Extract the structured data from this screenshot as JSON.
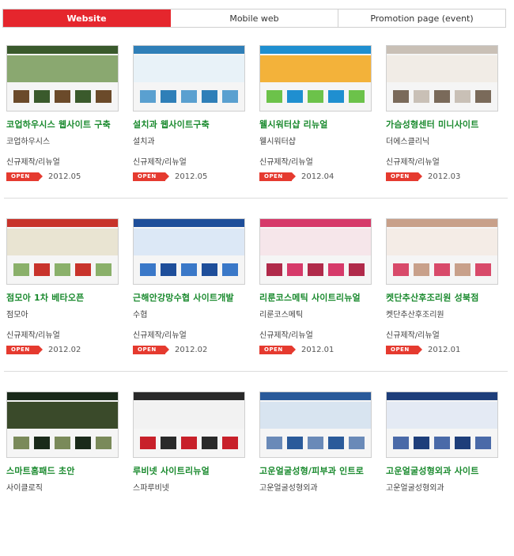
{
  "tabs": [
    {
      "label": "Website",
      "active": true
    },
    {
      "label": "Mobile web",
      "active": false
    },
    {
      "label": "Promotion page (event)",
      "active": false
    }
  ],
  "badge_label": "OPEN",
  "rows": [
    [
      {
        "title": "코업하우시스 웹사이트 구축",
        "client": "코업하우시스",
        "kind": "신규제작/리뉴얼",
        "date": "2012.05",
        "colors": [
          "#3a5a2c",
          "#8aa870",
          "#6b4a2a"
        ]
      },
      {
        "title": "설치과 웹사이트구축",
        "client": "설치과",
        "kind": "신규제작/리뉴얼",
        "date": "2012.05",
        "colors": [
          "#2f7fb8",
          "#e8f2f8",
          "#5aa0d0"
        ]
      },
      {
        "title": "웰시워터샵 리뉴얼",
        "client": "웰시워터샵",
        "kind": "신규제작/리뉴얼",
        "date": "2012.04",
        "colors": [
          "#1f8fd0",
          "#f3b23a",
          "#6cc24a"
        ]
      },
      {
        "title": "가슴성형센터 미니사이트",
        "client": "더에스클리닉",
        "kind": "신규제작/리뉴얼",
        "date": "2012.03",
        "colors": [
          "#c9c0b6",
          "#f1ece6",
          "#7a6a5a"
        ]
      }
    ],
    [
      {
        "title": "점모아 1차 베타오픈",
        "client": "점모아",
        "kind": "신규제작/리뉴얼",
        "date": "2012.02",
        "colors": [
          "#c8332b",
          "#e9e4d2",
          "#8ab06a"
        ]
      },
      {
        "title": "근해안강망수협 사이트개발",
        "client": "수협",
        "kind": "신규제작/리뉴얼",
        "date": "2012.02",
        "colors": [
          "#1e4e9a",
          "#dce8f6",
          "#3a78c8"
        ]
      },
      {
        "title": "리룬코스메틱 사이트리뉴얼",
        "client": "리룬코스메틱",
        "kind": "신규제작/리뉴얼",
        "date": "2012.01",
        "colors": [
          "#d63a6a",
          "#f6e6ea",
          "#b02a4a"
        ]
      },
      {
        "title": "켓단추산후조리원 성북점",
        "client": "켓단추산후조리원",
        "kind": "신규제작/리뉴얼",
        "date": "2012.01",
        "colors": [
          "#c8a08a",
          "#f4ece6",
          "#d84a6a"
        ]
      }
    ],
    [
      {
        "title": "스마트홈패드 초안",
        "client": "사이클로직",
        "kind": "",
        "date": "",
        "colors": [
          "#1a2a1a",
          "#3a4a2a",
          "#7a8a5a"
        ]
      },
      {
        "title": "루비넷 사이트리뉴얼",
        "client": "스파루비넷",
        "kind": "",
        "date": "",
        "colors": [
          "#2a2a2a",
          "#f2f2f2",
          "#c8202a"
        ]
      },
      {
        "title": "고운얼굴성형/피부과 인트로",
        "client": "고운얼굴성형외과",
        "kind": "",
        "date": "",
        "colors": [
          "#2a5a9a",
          "#d8e4f0",
          "#6a8ab8"
        ]
      },
      {
        "title": "고운얼굴성형외과 사이트",
        "client": "고운얼굴성형외과",
        "kind": "",
        "date": "",
        "colors": [
          "#1e3e7a",
          "#e4eaf4",
          "#4a6aa8"
        ]
      }
    ]
  ]
}
